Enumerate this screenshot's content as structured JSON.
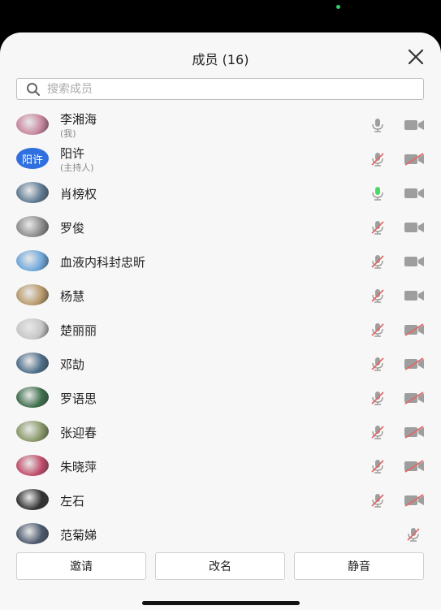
{
  "header": {
    "title": "成员 (16)"
  },
  "search": {
    "placeholder": "搜索成员"
  },
  "members": [
    {
      "name": "李湘海",
      "sub": "(我)",
      "avatar_color": "#c9869f",
      "mic": "on",
      "cam": "on"
    },
    {
      "name": "阳许",
      "sub": "(主持人)",
      "avatar_text": "阳许",
      "mic": "off",
      "cam": "off"
    },
    {
      "name": "肖榜权",
      "avatar_color": "#5e7a93",
      "mic": "speaking",
      "cam": "on"
    },
    {
      "name": "罗俊",
      "avatar_color": "#8d8d8d",
      "mic": "off",
      "cam": "on"
    },
    {
      "name": "血液内科封忠昕",
      "avatar_color": "#6fa8dc",
      "mic": "off",
      "cam": "on"
    },
    {
      "name": "杨慧",
      "avatar_color": "#b99b6b",
      "mic": "off",
      "cam": "on"
    },
    {
      "name": "楚丽丽",
      "avatar_color": "#c7c7c7",
      "mic": "off",
      "cam": "off"
    },
    {
      "name": "邓劼",
      "avatar_color": "#4e6e8a",
      "mic": "off",
      "cam": "off"
    },
    {
      "name": "罗语思",
      "avatar_color": "#3e6f4c",
      "mic": "off",
      "cam": "off"
    },
    {
      "name": "张迎春",
      "avatar_color": "#8a9a6a",
      "mic": "off",
      "cam": "off"
    },
    {
      "name": "朱晓萍",
      "avatar_color": "#c24d6b",
      "mic": "off",
      "cam": "off"
    },
    {
      "name": "左石",
      "avatar_color": "#333333",
      "mic": "off",
      "cam": "off"
    },
    {
      "name": "范菊娣",
      "avatar_color": "#4d5a6e",
      "mic": "off",
      "cam": "none"
    }
  ],
  "buttons": {
    "invite": "邀请",
    "rename": "改名",
    "mute": "静音"
  },
  "colors": {
    "icon_gray": "#9e9e9e",
    "muted_red": "#e06a6a",
    "speaking_green": "#4cd964",
    "host_blue": "#2f6fe0"
  },
  "icons": {
    "close": "close-icon",
    "search": "search-icon",
    "mic": "microphone-icon",
    "cam": "video-camera-icon"
  }
}
